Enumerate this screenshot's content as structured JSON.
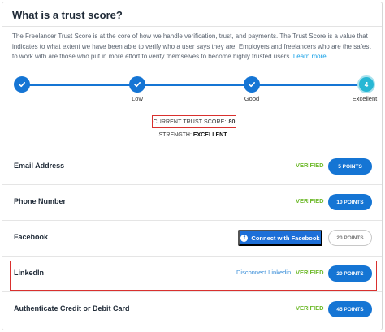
{
  "header": {
    "title": "What is a trust score?"
  },
  "intro": {
    "text": "The Freelancer Trust Score is at the core of how we handle verification, trust, and payments. The Trust Score is a value that indicates to what extent we have been able to verify who a user says they are. Employers and freelancers who are the safest to work with are those who put in more effort to verify themselves to become highly trusted users.",
    "learn_more": "Learn more."
  },
  "progress": {
    "steps": [
      {
        "label": "",
        "state": "done"
      },
      {
        "label": "Low",
        "state": "done"
      },
      {
        "label": "Good",
        "state": "done"
      },
      {
        "label": "Excellent",
        "state": "current",
        "number": "4"
      }
    ]
  },
  "score": {
    "label": "CURRENT TRUST SCORE:",
    "value": "80",
    "strength_label": "STRENGTH:",
    "strength_value": "EXCELLENT"
  },
  "rows": [
    {
      "label": "Email Address",
      "status": "VERIFIED",
      "points": "5 POINTS"
    },
    {
      "label": "Phone Number",
      "status": "VERIFIED",
      "points": "10 POINTS"
    },
    {
      "label": "Facebook",
      "action": "Connect with Facebook",
      "points": "20 POINTS"
    },
    {
      "label": "LinkedIn",
      "link": "Disconnect Linkedin",
      "status": "VERIFIED",
      "points": "20 POINTS"
    },
    {
      "label": "Authenticate Credit or Debit Card",
      "status": "VERIFIED",
      "points": "45 POINTS"
    }
  ],
  "colors": {
    "primary": "#1575d4",
    "current_step": "#27b7d4",
    "verified": "#6fba2c",
    "highlight": "#d9302e",
    "link": "#139fe6"
  },
  "icons": {
    "step_done": "check-icon",
    "facebook": "facebook-icon"
  }
}
